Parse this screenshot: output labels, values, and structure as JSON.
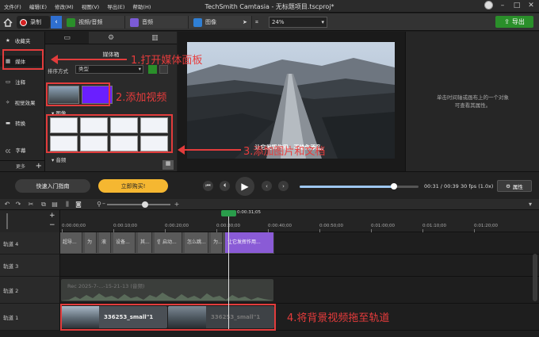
{
  "menu": [
    "文件(F)",
    "编辑(E)",
    "修改(M)",
    "视图(V)",
    "导出(E)",
    "帮助(H)"
  ],
  "window_title": "TechSmith Camtasia - 无标题项目.tscproj*",
  "toolbar": {
    "record_label": "录制",
    "tabs": [
      {
        "label": "视频/音频",
        "color": "#2a8f2a"
      },
      {
        "label": "音频",
        "color": "#7b5bd6"
      },
      {
        "label": "图像",
        "color": "#2f7fd4"
      }
    ],
    "zoom": "24%",
    "export_label": "导出"
  },
  "sidebar": {
    "items": [
      {
        "label": "收藏夹",
        "icon": "star-icon"
      },
      {
        "label": "媒体",
        "icon": "media-icon"
      },
      {
        "label": "注释",
        "icon": "annotation-icon"
      },
      {
        "label": "视觉效果",
        "icon": "wand-icon"
      },
      {
        "label": "转换",
        "icon": "transition-icon"
      },
      {
        "label": "字幕",
        "icon": "cc-icon"
      }
    ],
    "more_label": "更多"
  },
  "media_bin": {
    "title": "媒体箱",
    "sort_label": "排序方式",
    "sort_value": "类型",
    "images_section": "图像",
    "next_section": "音频"
  },
  "preview": {
    "subtitle": "让它发挥作用。不给你添乱。"
  },
  "properties": {
    "empty_text_line1": "单击时间轴或画布上的一个对象",
    "empty_text_line2": "可查看其属性。"
  },
  "controls": {
    "quick_start": "快速入门指南",
    "buy_now": "立即购买!",
    "time": "00:31 / 00:39",
    "fps": "30 fps (1.0x)",
    "props_button": "属性",
    "progress": 0.79
  },
  "timeline": {
    "playhead_time": "0:00:31;05",
    "ticks": [
      "0:00:00;00",
      "0:00:10;00",
      "0:00:20;00",
      "0:00:30;00",
      "0:00:40;00",
      "0:00:50;00",
      "0:01:00;00",
      "0:01:10;00",
      "0:01:20;00"
    ],
    "tracks": [
      "轨道 4",
      "轨道 3",
      "轨道 2",
      "轨道 1"
    ],
    "track4_clips": [
      "超导...",
      "为",
      "液",
      "设备...",
      "其...",
      "信...",
      "启动...",
      "怎么跳...",
      "为...",
      "让它发挥作用..."
    ],
    "track2_clip": "Rec 2025-7-...-15-21-13 (音频)",
    "track1_clips": [
      "336253_small\"1",
      "336253_small\"1"
    ]
  },
  "annotations": {
    "step1": "1.打开媒体面板",
    "step2": "2.添加视频",
    "step3": "3.添加图片和文档",
    "step4": "4.将背景视频拖至轨道"
  },
  "colors": {
    "accent_green": "#2a8f2a",
    "annotation_red": "#e23c3c",
    "buy_orange": "#f5b731",
    "clip_purple": "#8a5bd6"
  }
}
